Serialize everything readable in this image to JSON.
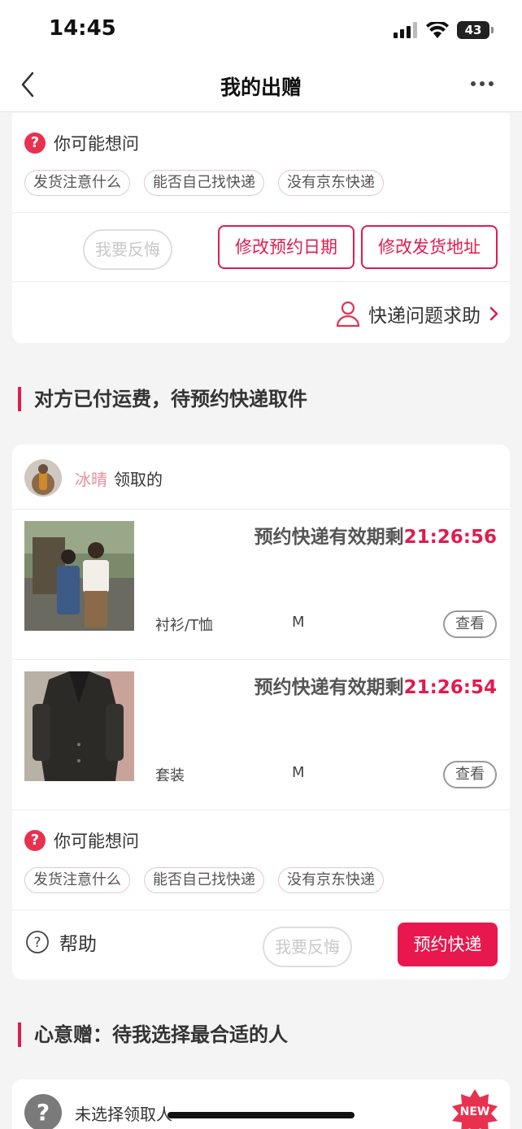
{
  "status_bar": {
    "time": "14:45",
    "battery": "43"
  },
  "nav": {
    "title": "我的出赠"
  },
  "top_card": {
    "faq_title": "你可能想问",
    "chips": [
      "发货注意什么",
      "能否自己找快递",
      "没有京东快递"
    ],
    "regret_button": "我要反悔",
    "change_date_button": "修改预约日期",
    "change_address_button": "修改发货地址",
    "help_link": "快递问题求助"
  },
  "section1": {
    "title": "对方已付运费，待预约快递取件"
  },
  "order_card": {
    "receiver_name": "冰晴",
    "receiver_suffix": "领取的",
    "items": [
      {
        "countdown_label": "预约快递有效期剩",
        "countdown_time": "21:26:56",
        "category": "衬衫/T恤",
        "size": "M",
        "view_button": "查看"
      },
      {
        "countdown_label": "预约快递有效期剩",
        "countdown_time": "21:26:54",
        "category": "套装",
        "size": "M",
        "view_button": "查看"
      }
    ],
    "faq_title": "你可能想问",
    "chips": [
      "发货注意什么",
      "能否自己找快递",
      "没有京东快递"
    ],
    "help_label": "帮助",
    "regret_button": "我要反悔",
    "book_button": "预约快递"
  },
  "section2": {
    "title": "心意赠：待我选择最合适的人"
  },
  "gift_card": {
    "text": "未选择领取人",
    "badge": "NEW"
  },
  "colors": {
    "accent": "#e01c4e",
    "badge": "#e8304f"
  }
}
